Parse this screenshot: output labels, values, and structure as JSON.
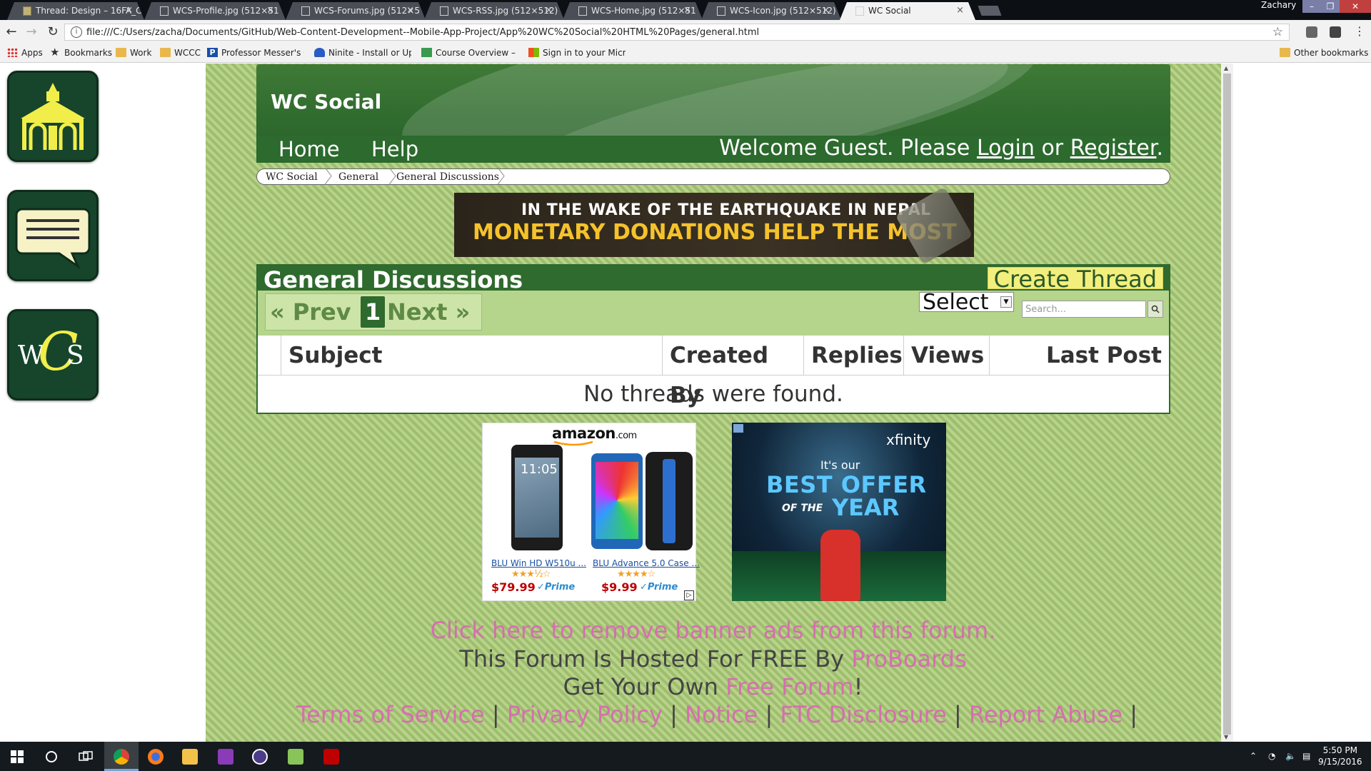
{
  "browser": {
    "tabs": [
      {
        "label": "Thread: Design – 16FA_C",
        "icon": "forum-icon"
      },
      {
        "label": "WCS-Profile.jpg (512×51",
        "icon": "page-icon"
      },
      {
        "label": "WCS-Forums.jpg (512×5",
        "icon": "page-icon"
      },
      {
        "label": "WCS-RSS.jpg (512×512)",
        "icon": "page-icon"
      },
      {
        "label": "WCS-Home.jpg (512×51",
        "icon": "page-icon"
      },
      {
        "label": "WCS-Icon.jpg (512×512)",
        "icon": "page-icon"
      },
      {
        "label": "WC Social",
        "icon": "page-icon",
        "active": true
      }
    ],
    "profile_name": "Zachary",
    "address": "file:///C:/Users/zacha/Documents/GitHub/Web-Content-Development--Mobile-App-Project/App%20WC%20Social%20HTML%20Pages/general.html",
    "bookmarks": [
      {
        "label": "Apps",
        "icon": "apps-grid-icon"
      },
      {
        "label": "Bookmarks",
        "icon": "star-icon"
      },
      {
        "label": "Work",
        "icon": "folder-icon"
      },
      {
        "label": "WCCC",
        "icon": "folder-icon"
      },
      {
        "label": "Professor Messer's Co",
        "icon": "professor-messer-icon"
      },
      {
        "label": "Ninite - Install or Upd",
        "icon": "ninite-icon"
      },
      {
        "label": "Course Overview – Go",
        "icon": "course-icon"
      },
      {
        "label": "Sign in to your Micro",
        "icon": "microsoft-icon"
      }
    ],
    "other_bookmarks": "Other bookmarks"
  },
  "site": {
    "title": "WC Social",
    "nav": {
      "home": "Home",
      "help": "Help"
    },
    "welcome_prefix": "Welcome Guest. Please",
    "login": "Login",
    "or": "or",
    "register": "Register",
    "period": ".",
    "breadcrumb": [
      "WC Social",
      "General",
      "General Discussions"
    ],
    "side_icons": [
      "home-gazebo-icon",
      "chat-bubble-icon",
      "wcs-logo-icon"
    ],
    "wcs_logo_text": "WCS"
  },
  "banner_ad": {
    "line1": "IN THE WAKE OF THE EARTHQUAKE IN NEPAL",
    "line2": "MONETARY DONATIONS HELP THE MOST"
  },
  "forum": {
    "title": "General Discussions",
    "create_thread": "Create Thread",
    "pager": {
      "prev": "« Prev",
      "current": "1",
      "next": "Next »"
    },
    "select_value": "Select",
    "search_placeholder": "Search...",
    "columns": [
      "Subject",
      "Created By",
      "Replies",
      "Views",
      "Last Post"
    ],
    "empty_message": "No threads were found."
  },
  "amazon_ad": {
    "brand": "amazon",
    "brand_tld": ".com",
    "phone_time": "11:05",
    "products": [
      {
        "name": "BLU Win HD W510u ...",
        "stars": "★★★½☆",
        "rating": 3.5,
        "price": "$79.99",
        "prime": "✓Prime"
      },
      {
        "name": "BLU Advance 5.0 Case ...",
        "stars": "★★★★☆",
        "rating": 4,
        "price": "$9.99",
        "prime": "✓Prime"
      }
    ]
  },
  "xfinity_ad": {
    "brand": "xfinity",
    "line1": "It's our",
    "line2": "BEST OFFER",
    "line3": "OF THE",
    "line4": "YEAR"
  },
  "footer": {
    "remove_ads": "Click here to remove banner ads from this forum.",
    "hosted_prefix": "This Forum Is Hosted For FREE By",
    "proboards": "ProBoards",
    "get_own_prefix": "Get Your Own",
    "free_forum": "Free Forum",
    "get_own_suffix": "!",
    "links": [
      "Terms of Service",
      "Privacy Policy",
      "Notice",
      "FTC Disclosure",
      "Report Abuse"
    ],
    "separator": "|"
  },
  "taskbar": {
    "apps": [
      "start-icon",
      "cortana-icon",
      "task-view-icon",
      "chrome-icon",
      "firefox-icon",
      "file-explorer-icon",
      "onenote-icon",
      "app-icon",
      "notepad-icon",
      "filezilla-icon"
    ],
    "time": "5:50 PM",
    "date": "9/15/2016"
  }
}
